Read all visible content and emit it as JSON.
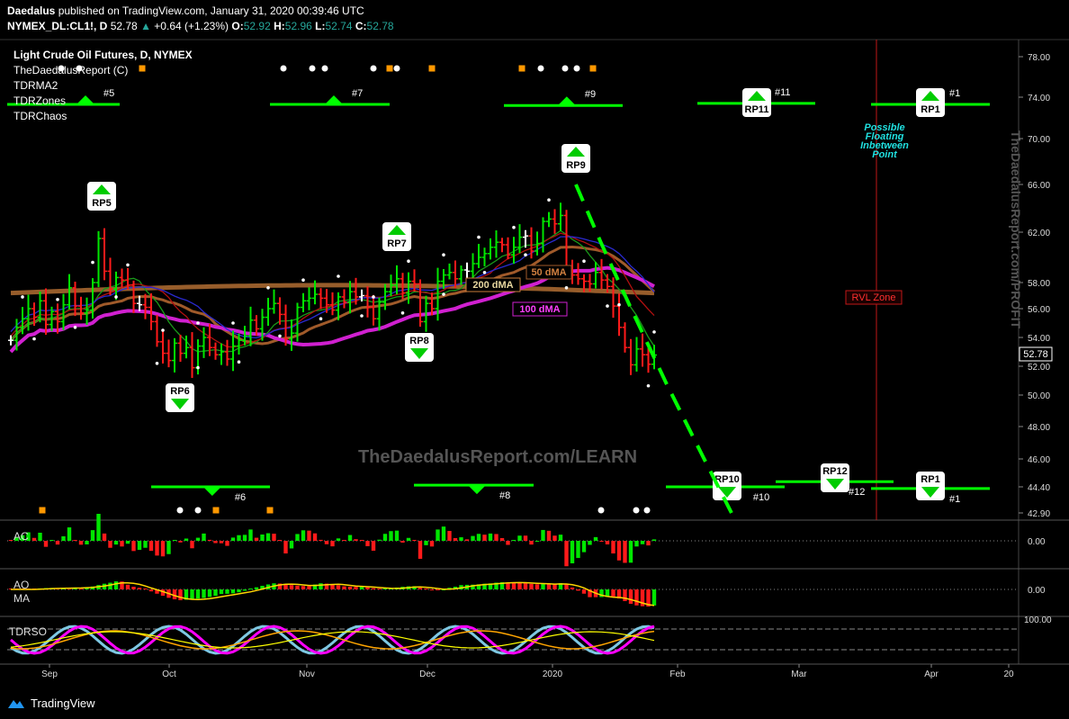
{
  "header": {
    "author": "Daedalus",
    "published_line": "published on TradingView.com, January 31, 2020 00:39:46 UTC",
    "symbol_line_prefix": "NYMEX_DL:CL1!, D",
    "last": "52.78",
    "change": "+0.64 (+1.23%)",
    "o_label": "O:",
    "o": "52.92",
    "h_label": "H:",
    "h": "52.96",
    "l_label": "L:",
    "l": "52.74",
    "c_label": "C:",
    "c": "52.78"
  },
  "legend": {
    "title": "Light Crude Oil Futures, D, NYMEX",
    "studies": [
      "TheDaedalusReport (C)",
      "TDRMA2",
      "TDRZones",
      "TDRChaos"
    ]
  },
  "colors": {
    "bull": "#00e600",
    "bear": "#ff1a1a",
    "neutral": "#ffffff",
    "ma200": "#c97c3a",
    "ma100": "#d020d0",
    "ma50": "#a05a2a",
    "zone": "#00ff00",
    "rvl": "#ff2020",
    "aqua": "#20e0e0",
    "grid_dots": "#888888"
  },
  "chart_data": [
    {
      "type": "candlestick",
      "title": "Light Crude Oil Futures, D, NYMEX",
      "ylim": [
        42.0,
        79.0
      ],
      "y_ticks": [
        "78.00",
        "74.00",
        "70.00",
        "66.00",
        "62.00",
        "58.00",
        "56.00",
        "54.00",
        "52.00",
        "50.00",
        "48.00",
        "46.00",
        "44.40",
        "42.90"
      ],
      "x_ticks": [
        "Sep",
        "Oct",
        "Nov",
        "Dec",
        "2020",
        "Feb",
        "Mar",
        "Apr",
        "20"
      ],
      "last_price_label": "52.78",
      "closes": [
        53.8,
        54.7,
        55.3,
        56.0,
        55.4,
        56.6,
        54.9,
        55.8,
        55.1,
        56.3,
        57.6,
        56.2,
        55.7,
        55.9,
        58.0,
        61.5,
        58.9,
        57.5,
        58.4,
        58.2,
        57.8,
        56.4,
        56.3,
        56.1,
        55.1,
        53.7,
        52.9,
        52.4,
        53.6,
        52.9,
        53.3,
        51.9,
        53.4,
        54.0,
        53.3,
        52.8,
        53.0,
        52.5,
        53.4,
        53.8,
        54.1,
        55.2,
        54.6,
        55.4,
        56.0,
        56.4,
        55.6,
        53.9,
        54.3,
        56.1,
        56.6,
        56.8,
        57.1,
        56.8,
        56.3,
        55.9,
        56.9,
        56.5,
        57.3,
        56.9,
        57.0,
        56.1,
        55.3,
        56.5,
        57.3,
        57.8,
        58.3,
        57.2,
        58.1,
        57.9,
        55.1,
        56.4,
        56.0,
        58.1,
        58.6,
        58.8,
        58.3,
        59.0,
        58.9,
        59.5,
        60.0,
        60.3,
        60.8,
        61.2,
        61.0,
        60.2,
        60.8,
        61.6,
        61.7,
        60.5,
        61.1,
        62.9,
        63.1,
        62.7,
        63.4,
        59.1,
        58.6,
        58.3,
        58.1,
        57.9,
        58.8,
        58.2,
        57.7,
        56.2,
        54.7,
        53.3,
        52.1,
        53.2,
        52.8,
        52.14,
        52.78
      ],
      "dma": [
        {
          "name": "200 dMA"
        },
        {
          "name": "50 dMA"
        },
        {
          "name": "100 dMA"
        }
      ],
      "reversal_points": [
        "RP5",
        "RP6",
        "RP7",
        "RP8",
        "RP9",
        "RP10",
        "RP11",
        "RP12",
        "RP1",
        "RP1"
      ],
      "zones_top": [
        "#5",
        "#7",
        "#9",
        "#11",
        "#1"
      ],
      "zones_bottom": [
        "#6",
        "#8",
        "#10",
        "#12",
        "#1"
      ],
      "annotations": [
        "Possible Floating Inbetween Point",
        "RVL Zone",
        "TheDaedalusReport.com/LEARN",
        "TheDaedalusReport.com/PROFIT"
      ],
      "zone_levels": {
        "top": [
          73.3,
          73.3,
          73.2,
          73.4,
          73.3
        ],
        "bottom": [
          44.4,
          44.5,
          44.4,
          44.7,
          44.3
        ]
      }
    },
    {
      "type": "bar",
      "title": "AC",
      "ylim": [
        -1,
        1
      ],
      "y_ticks": [
        "0.00"
      ]
    },
    {
      "type": "bar",
      "title": "AO",
      "subtitle": "MA",
      "ylim": [
        -1,
        1
      ],
      "y_ticks": [
        "0.00"
      ]
    },
    {
      "type": "line",
      "title": "TDRSO",
      "ylim": [
        0,
        100
      ],
      "y_ticks": [
        "100.00"
      ]
    }
  ]
}
